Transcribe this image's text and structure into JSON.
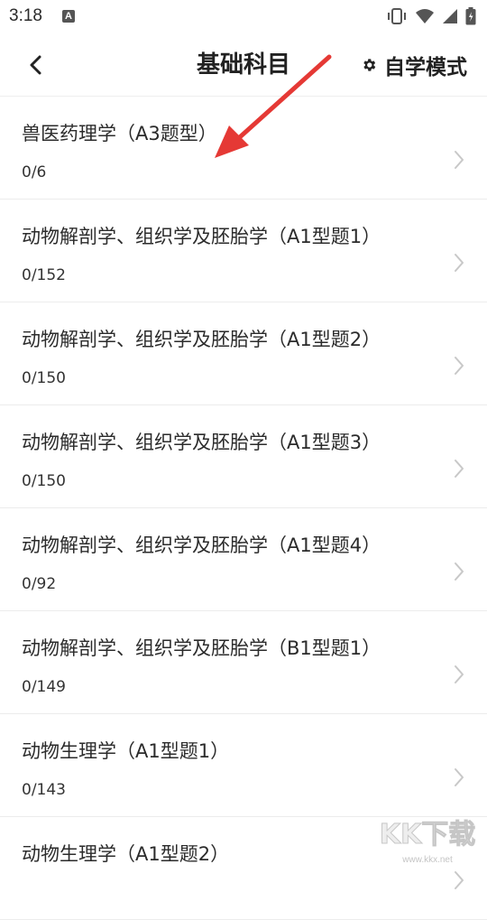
{
  "status_bar": {
    "time": "3:18",
    "notification_icon": "A"
  },
  "header": {
    "title": "基础科目",
    "back_icon": "chevron-left-icon",
    "self_study_label": "自学模式",
    "self_study_icon": "gear-icon"
  },
  "items": [
    {
      "title": "兽医药理学（A3题型）",
      "progress": "0/6"
    },
    {
      "title": "动物解剖学、组织学及胚胎学（A1型题1）",
      "progress": "0/152"
    },
    {
      "title": "动物解剖学、组织学及胚胎学（A1型题2）",
      "progress": "0/150"
    },
    {
      "title": "动物解剖学、组织学及胚胎学（A1型题3）",
      "progress": "0/150"
    },
    {
      "title": "动物解剖学、组织学及胚胎学（A1型题4）",
      "progress": "0/92"
    },
    {
      "title": "动物解剖学、组织学及胚胎学（B1型题1）",
      "progress": "0/149"
    },
    {
      "title": "动物生理学（A1型题1）",
      "progress": "0/143"
    },
    {
      "title": "动物生理学（A1型题2）",
      "progress": ""
    }
  ],
  "watermark": {
    "text": "KK下载",
    "url": "www.kkx.net"
  },
  "colors": {
    "annotation_arrow": "#e53935",
    "divider": "#ececec",
    "chevron": "#c8c8c8"
  }
}
